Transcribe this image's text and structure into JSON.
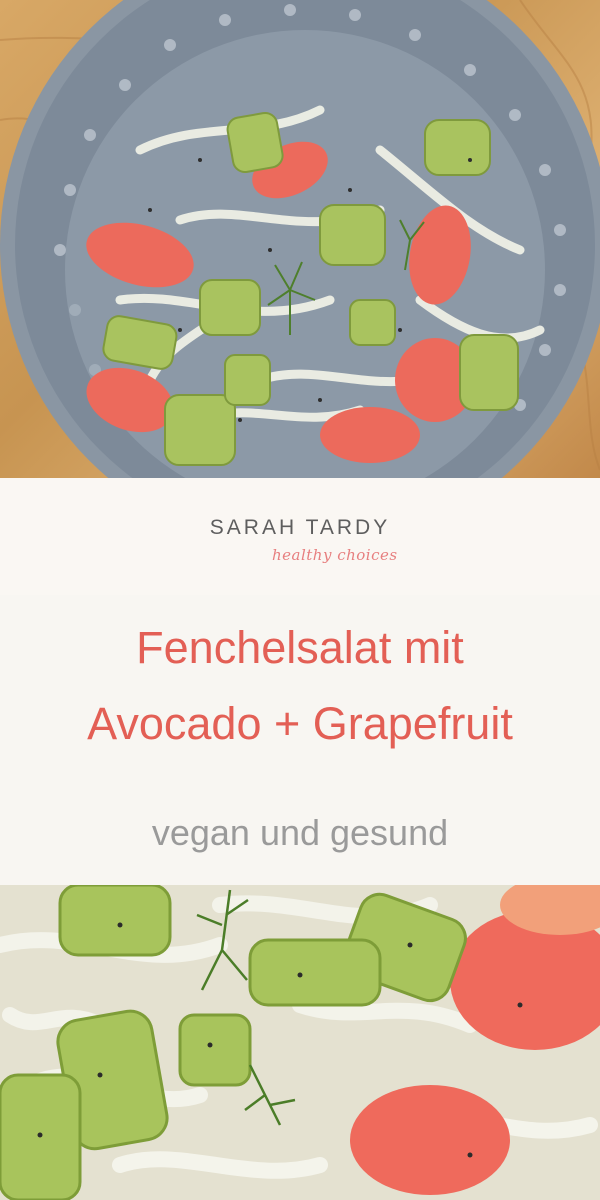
{
  "brand": {
    "name": "SARAH  TARDY",
    "tagline": "healthy choices",
    "tagline_color": "#e77f7f"
  },
  "title": {
    "line1": "Fenchelsalat mit",
    "line2": "Avocado + Grapefruit",
    "color": "#e35f55"
  },
  "subtitle": "vegan und gesund",
  "photos": {
    "top": "salad-plate-photo",
    "bottom": "salad-closeup-photo"
  }
}
